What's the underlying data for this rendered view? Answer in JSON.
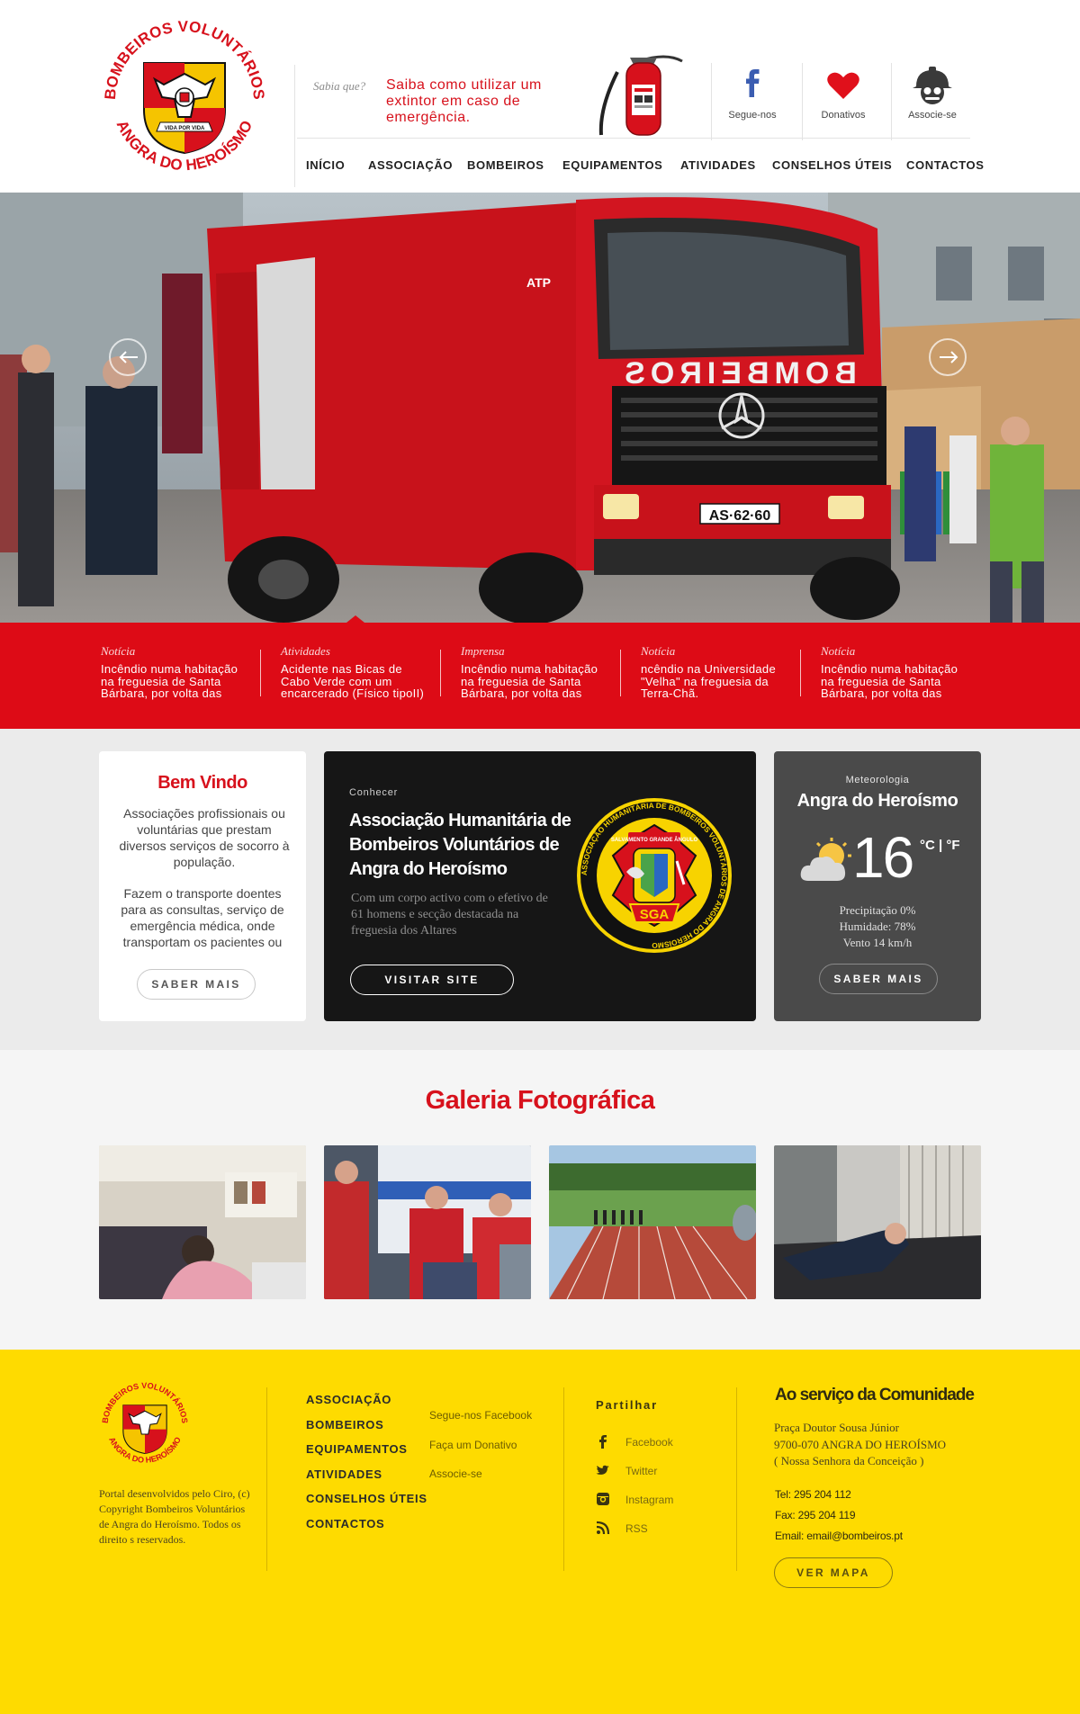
{
  "brand": {
    "logo_text_top": "BOMBEIROS VOLUNTÁRIOS",
    "logo_text_bottom": "ANGRA DO HEROÍSMO",
    "logo_motto": "VIDA POR VIDA",
    "red": "#d7111c",
    "yellow": "#fedb00"
  },
  "header": {
    "sabia_label": "Sabia que?",
    "sabia_text": "Saiba como utilizar um extintor em caso de emergência.",
    "social": [
      {
        "label": "Segue-nos",
        "icon": "facebook-icon"
      },
      {
        "label": "Donativos",
        "icon": "heart-icon"
      },
      {
        "label": "Associe-se",
        "icon": "firefighter-icon"
      }
    ]
  },
  "nav": [
    "INÍCIO",
    "ASSOCIAÇÃO",
    "BOMBEIROS",
    "EQUIPAMENTOS",
    "ATIVIDADES",
    "CONSELHOS ÚTEIS",
    "CONTACTOS"
  ],
  "hero": {
    "truck_text": "BOMBEIROS",
    "plate": "AS·62·60",
    "cab_text": "ATP",
    "prev_icon": "arrow-left-icon",
    "next_icon": "arrow-right-icon"
  },
  "news": [
    {
      "category": "Notícia",
      "title": "Incêndio numa habitação na freguesia de Santa Bárbara, por volta das"
    },
    {
      "category": "Atividades",
      "title": "Acidente nas Bicas de Cabo Verde com um encarcerado (Físico tipoII)"
    },
    {
      "category": "Imprensa",
      "title": "Incêndio numa habitação na freguesia de Santa Bárbara, por volta das"
    },
    {
      "category": "Notícia",
      "title": "ncêndio na Universidade \"Velha\" na freguesia da Terra-Chã."
    },
    {
      "category": "Notícia",
      "title": "Incêndio numa habitação na freguesia de Santa Bárbara, por volta das"
    }
  ],
  "welcome": {
    "title": "Bem Vindo",
    "para1": "Associações profissionais ou voluntárias que prestam diversos serviços de socorro à população.",
    "para2": "Fazem o transporte doentes para as consultas, serviço de emergência médica, onde transportam os pacientes ou",
    "button": "SABER MAIS"
  },
  "association": {
    "kicker": "Conhecer",
    "title": "Associação Humanitária de Bombeiros Voluntários de Angra do Heroísmo",
    "text": "Com um corpo activo com o efetivo de 61 homens e secção destacada na freguesia dos Altares",
    "button": "VISITAR SITE",
    "badge_ring_text": "ASSOCIAÇÃO HUMANITÁRIA DE BOMBEIROS VOLUNTÁRIOS DE ANGRA DO HEROÍSMO",
    "badge_banner": "SALVAMENTO GRANDE ÂNGULO",
    "badge_code": "SGA"
  },
  "weather": {
    "kicker": "Meteorologia",
    "city": "Angra do Heroísmo",
    "temperature": "16",
    "units": "°C | °F",
    "precip": "Precipitação 0%",
    "humidity": "Humidade: 78%",
    "wind": "Vento 14 km/h",
    "button": "SABER MAIS",
    "icon": "partly-cloudy-icon"
  },
  "gallery": {
    "title": "Galeria Fotográfica"
  },
  "footer": {
    "credits": "Portal desenvolvidos pelo Ciro, (c) Copyright Bombeiros Voluntários de Angra do Heroísmo. Todos os direito s reservados.",
    "nav": [
      "ASSOCIAÇÃO",
      "BOMBEIROS",
      "EQUIPAMENTOS",
      "ATIVIDADES",
      "CONSELHOS ÚTEIS",
      "CONTACTOS"
    ],
    "links": [
      "Segue-nos Facebook",
      "Faça um Donativo",
      "Associe-se"
    ],
    "share_title": "Partilhar",
    "share": [
      {
        "label": "Facebook",
        "icon": "facebook-icon"
      },
      {
        "label": "Twitter",
        "icon": "twitter-icon"
      },
      {
        "label": "Instagram",
        "icon": "instagram-icon"
      },
      {
        "label": "RSS",
        "icon": "rss-icon"
      }
    ],
    "community_title": "Ao serviço da Comunidade",
    "address1": "Praça Doutor Sousa Júnior",
    "address2": "9700-070 ANGRA DO HEROÍSMO",
    "address3": "( Nossa Senhora da Conceição )",
    "tel": "Tel: 295 204 112",
    "fax": "Fax: 295 204 119",
    "email": "Email: email@bombeiros.pt",
    "map_button": "VER MAPA"
  }
}
